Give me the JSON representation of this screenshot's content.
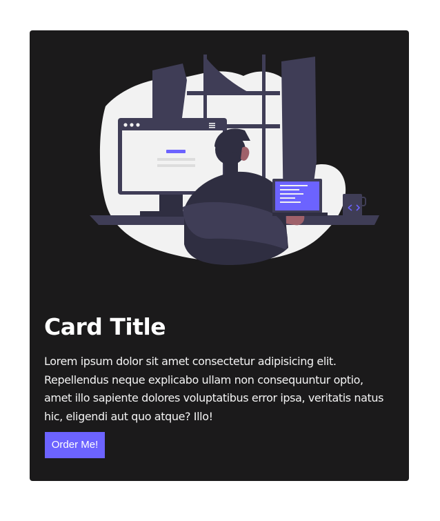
{
  "card": {
    "illustration_name": "developer-at-workstation-illustration",
    "title": "Card Title",
    "text": "Lorem ipsum dolor sit amet consectetur adipisicing elit. Repellendus neque explicabo ullam non consequuntur optio, amet illo sapiente dolores voluptatibus error ipsa, veritatis natus hic, eligendi aut quo atque? Illo!",
    "button_label": "Order Me!"
  },
  "colors": {
    "page_background": "#ffffff",
    "card_background": "#1b1a1b",
    "accent": "#6c63ff",
    "title_text": "#ffffff",
    "body_text": "#f4f4f4"
  }
}
